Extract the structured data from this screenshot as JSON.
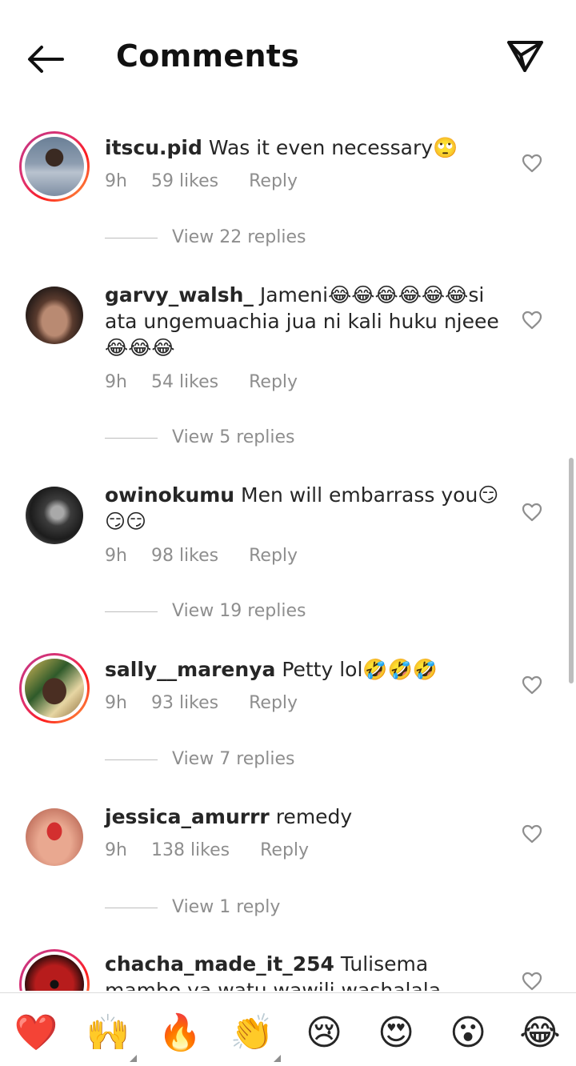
{
  "header": {
    "title": "Comments",
    "back_icon": "arrow-left-icon",
    "share_icon": "paper-plane-icon"
  },
  "comments": [
    {
      "username": "itscu.pid",
      "text": "Was it even necessary🙄",
      "time": "9h",
      "likes": "59 likes",
      "reply": "Reply",
      "view_replies": "View 22 replies",
      "story_ring": true
    },
    {
      "username": "garvy_walsh_",
      "text": " Jameni😂😂😂😂😂😂si ata ungemuachia jua ni kali huku njeee😂😂😂",
      "time": "9h",
      "likes": "54 likes",
      "reply": "Reply",
      "view_replies": "View 5 replies",
      "story_ring": false
    },
    {
      "username": "owinokumu",
      "text": "Men will embarrass you😏😏😏",
      "time": "9h",
      "likes": "98 likes",
      "reply": "Reply",
      "view_replies": "View 19 replies",
      "story_ring": false
    },
    {
      "username": "sally__marenya",
      "text": "Petty lol🤣🤣🤣",
      "time": "9h",
      "likes": "93 likes",
      "reply": "Reply",
      "view_replies": "View 7 replies",
      "story_ring": true
    },
    {
      "username": "jessica_amurrr",
      "text": "remedy",
      "time": "9h",
      "likes": "138 likes",
      "reply": "Reply",
      "view_replies": "View 1 reply",
      "story_ring": false
    },
    {
      "username": "chacha_made_it_254",
      "text": "Tulisema mambo ya watu wawili washalala pamoja",
      "story_ring": true
    }
  ],
  "emoji_bar": [
    "❤️",
    "🙌",
    "🔥",
    "👏",
    "😢",
    "😍",
    "😮",
    "😂"
  ],
  "colors": {
    "text": "#262626",
    "muted": "#8e8e8e",
    "ring_start": "#c13584",
    "ring_end": "#fcaf45"
  }
}
